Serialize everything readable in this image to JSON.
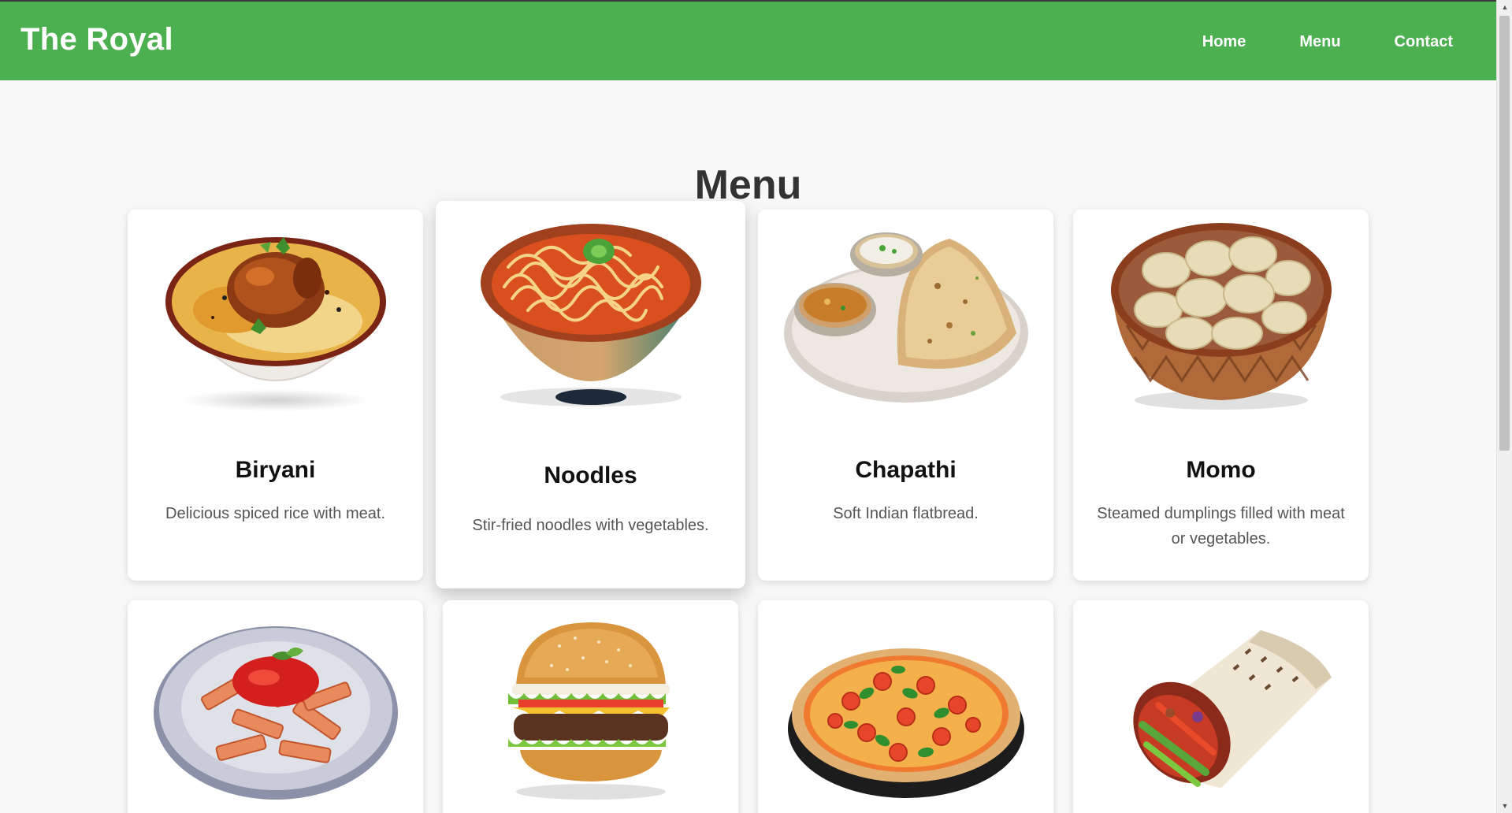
{
  "brand": "The Royal",
  "nav": {
    "home": "Home",
    "menu": "Menu",
    "contact": "Contact"
  },
  "page_title": "Menu",
  "items": [
    {
      "name": "Biryani",
      "description": "Delicious spiced rice with meat.",
      "icon": "biryani-image"
    },
    {
      "name": "Noodles",
      "description": "Stir-fried noodles with vegetables.",
      "icon": "noodles-image"
    },
    {
      "name": "Chapathi",
      "description": "Soft Indian flatbread.",
      "icon": "chapathi-image"
    },
    {
      "name": "Momo",
      "description": "Steamed dumplings filled with meat or vegetables.",
      "icon": "momo-image"
    },
    {
      "name": "",
      "description": "",
      "icon": "pasta-image"
    },
    {
      "name": "",
      "description": "",
      "icon": "burger-image"
    },
    {
      "name": "",
      "description": "",
      "icon": "pizza-image"
    },
    {
      "name": "",
      "description": "",
      "icon": "wrap-image"
    }
  ],
  "colors": {
    "header": "#4caf50",
    "background": "#f8f8f8",
    "card": "#ffffff"
  }
}
